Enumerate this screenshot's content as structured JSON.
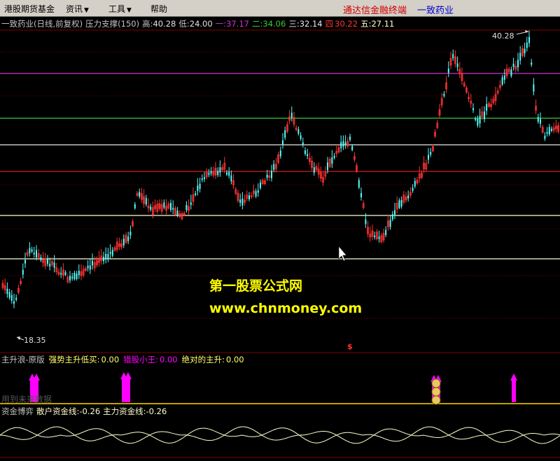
{
  "menu": {
    "items": [
      {
        "label": "港股期货基金",
        "arrow": false
      },
      {
        "label": "资讯",
        "arrow": true
      },
      {
        "label": "工具",
        "arrow": true
      },
      {
        "label": "帮助",
        "arrow": false
      }
    ],
    "brand": "通达信金融终端",
    "stock": "一致药业"
  },
  "header": {
    "title": "一致药业(日线,前复权)",
    "indicator": "压力支撑(150)",
    "high_label": "高:",
    "high_value": "40.28",
    "low_label": "低:",
    "low_value": "24.00",
    "l1_label": "一:",
    "l1_value": "37.17",
    "l2_label": "二:",
    "l2_value": "34.06",
    "l3_label": "三:",
    "l3_value": "32.14",
    "l4_label": "四",
    "l4_value": "30.22",
    "l5_label": "五:",
    "l5_value": "27.11"
  },
  "chart": {
    "high_marker": "40.28",
    "low_marker": "18.35",
    "dollar_marker": "$"
  },
  "watermark": {
    "line1": "第一股票公式网",
    "line2": "www.chnmoney.com"
  },
  "pane2": {
    "name": "主升浪-原版",
    "f1_label": "强势主升低买:",
    "f1_value": "0.00",
    "f2_label": "猎股小王:",
    "f2_value": "0.00",
    "f3_label": "绝对的主升:",
    "f3_value": "0.00",
    "ghost": "用到未来数据"
  },
  "pane3": {
    "name": "资金博弈",
    "f1_label": "散户资金线:",
    "f1_value": "-0.26",
    "f2_label": "主力资金线:",
    "f2_value": "-0.26"
  },
  "colors": {
    "up": "#ff3232",
    "down": "#54ffff",
    "level_purple": "#cc33cc",
    "level_green": "#33cc33",
    "level_white": "#e8e8e8",
    "level_red": "#cc2222",
    "level_yellow": "#ffffcc",
    "signal_magenta": "#ff00ff",
    "money_line": "#ffffcc"
  }
}
